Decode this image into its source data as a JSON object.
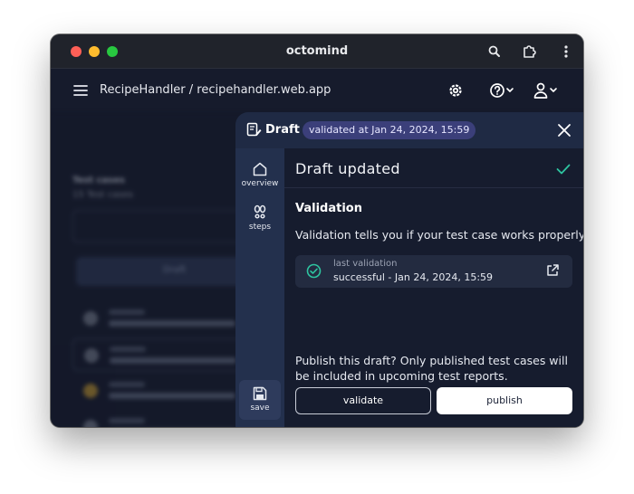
{
  "window": {
    "title": "octomind"
  },
  "appbar": {
    "breadcrumb": "RecipeHandler / recipehandler.web.app"
  },
  "background": {
    "field_label": "Test cases",
    "field_sub": "15 Test cases",
    "button_label": "Draft",
    "rows": [
      {
        "tag": "draft",
        "text": "Background one"
      },
      {
        "tag": "draft",
        "text": "Second item"
      },
      {
        "tag": "active",
        "text": "Third entry"
      },
      {
        "tag": "draft",
        "text": "Fourth entry"
      }
    ]
  },
  "panel": {
    "title": "Draft",
    "badge": "validated at Jan 24, 2024, 15:59",
    "rail": {
      "overview_label": "overview",
      "steps_label": "steps",
      "save_label": "save"
    },
    "heading": "Draft updated",
    "validation": {
      "title": "Validation",
      "description": "Validation tells you if your test case works properly.",
      "last_label": "last validation",
      "last_value": "successful - Jan 24, 2024, 15:59"
    },
    "publish_prompt": "Publish this draft? Only published test cases will be included in upcoming test reports.",
    "validate_button": "validate",
    "publish_button": "publish"
  },
  "colors": {
    "success": "#2ec4a0",
    "badge_bg": "#3b3f7a",
    "panel_bg": "#1b2236"
  }
}
